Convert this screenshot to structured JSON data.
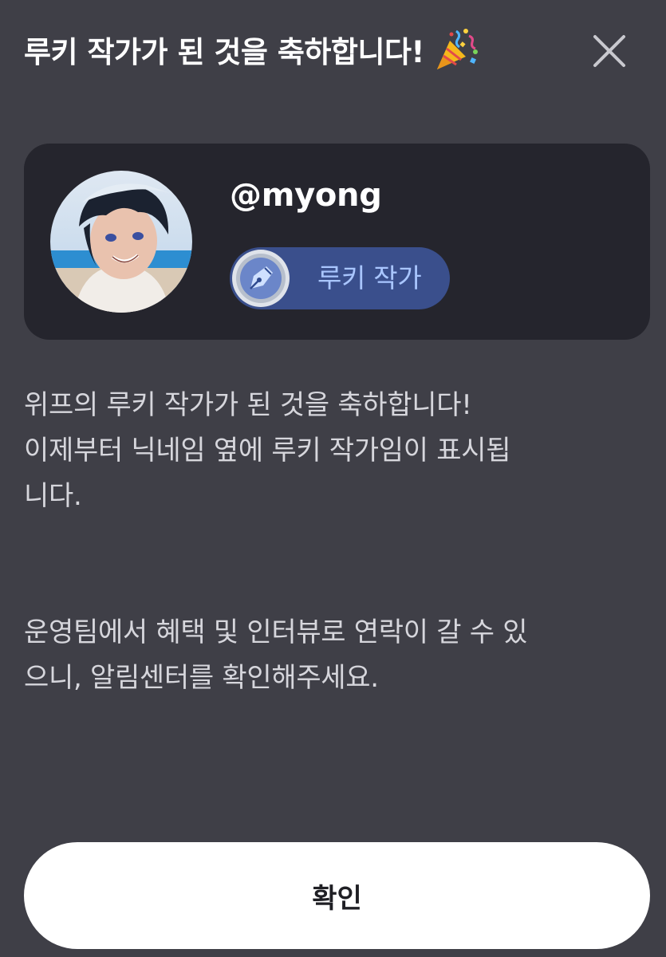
{
  "dialog": {
    "title": "루키 작가가 된 것을 축하합니다!",
    "title_icon": "party-popper-icon",
    "close_icon": "close-icon"
  },
  "profile": {
    "avatar_icon": "avatar-image",
    "username": "@myong",
    "badge": {
      "icon": "fountain-pen-icon",
      "label": "루키 작가",
      "color": "#3a4f8c",
      "label_color": "#a9c6ff"
    }
  },
  "message": {
    "line1": "위프의 루키 작가가 된 것을 축하합니다!",
    "line2": "이제부터 닉네임 옆에 루키 작가임이 표시됩",
    "line3": "니다.",
    "line4": "운영팀에서 혜택 및 인터뷰로 연락이 갈 수 있",
    "line5": "으니, 알림센터를 확인해주세요."
  },
  "actions": {
    "confirm_label": "확인"
  },
  "colors": {
    "background": "#3f3f47",
    "card": "#25252d",
    "button": "#ffffff"
  }
}
